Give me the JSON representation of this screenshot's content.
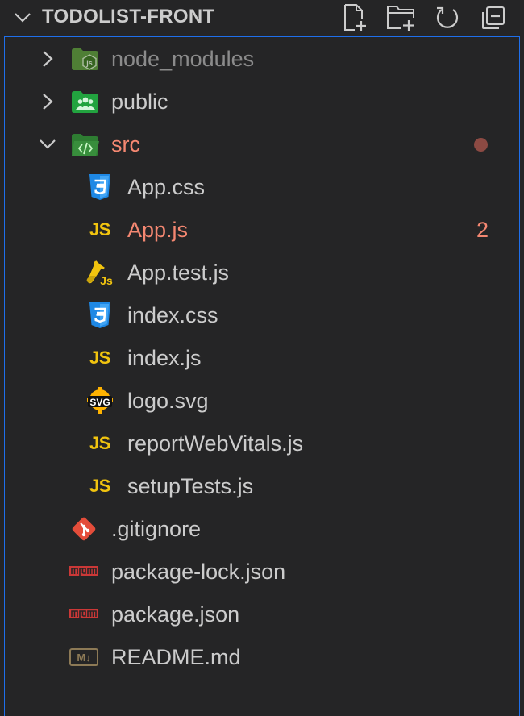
{
  "explorer": {
    "title": "TODOLIST-FRONT",
    "actions": [
      {
        "name": "new-file-icon"
      },
      {
        "name": "new-folder-icon"
      },
      {
        "name": "refresh-icon"
      },
      {
        "name": "collapse-all-icon"
      }
    ]
  },
  "tree": {
    "items": [
      {
        "label": "node_modules",
        "kind": "folder",
        "icon": "folder-node-icon",
        "expanded": false,
        "dimmed": true
      },
      {
        "label": "public",
        "kind": "folder",
        "icon": "folder-public-icon",
        "expanded": false
      },
      {
        "label": "src",
        "kind": "folder",
        "icon": "folder-src-icon",
        "expanded": true,
        "status": "modified",
        "status_color": "#8c4a43"
      },
      {
        "label": "App.css",
        "kind": "file",
        "icon": "css-file-icon"
      },
      {
        "label": "App.js",
        "kind": "file",
        "icon": "js-file-icon",
        "problems": "2",
        "problem_color": "#f48771"
      },
      {
        "label": "App.test.js",
        "kind": "file",
        "icon": "test-js-file-icon"
      },
      {
        "label": "index.css",
        "kind": "file",
        "icon": "css-file-icon"
      },
      {
        "label": "index.js",
        "kind": "file",
        "icon": "js-file-icon"
      },
      {
        "label": "logo.svg",
        "kind": "file",
        "icon": "svg-file-icon"
      },
      {
        "label": "reportWebVitals.js",
        "kind": "file",
        "icon": "js-file-icon"
      },
      {
        "label": "setupTests.js",
        "kind": "file",
        "icon": "js-file-icon"
      },
      {
        "label": ".gitignore",
        "kind": "file",
        "icon": "git-file-icon"
      },
      {
        "label": "package-lock.json",
        "kind": "file",
        "icon": "npm-file-icon"
      },
      {
        "label": "package.json",
        "kind": "file",
        "icon": "npm-file-icon"
      },
      {
        "label": "README.md",
        "kind": "file",
        "icon": "markdown-file-icon"
      }
    ]
  },
  "icon_text": {
    "js": "JS",
    "svg": "SVG",
    "md": "M↓"
  },
  "colors": {
    "background": "#252526",
    "focus_border": "#1f6feb",
    "error_text": "#f48771",
    "js_yellow": "#f1c40f",
    "css_blue": "#1e88e5",
    "folder_green": "#2e7d32",
    "git_red": "#e44d3a",
    "npm_red": "#cb3837"
  }
}
